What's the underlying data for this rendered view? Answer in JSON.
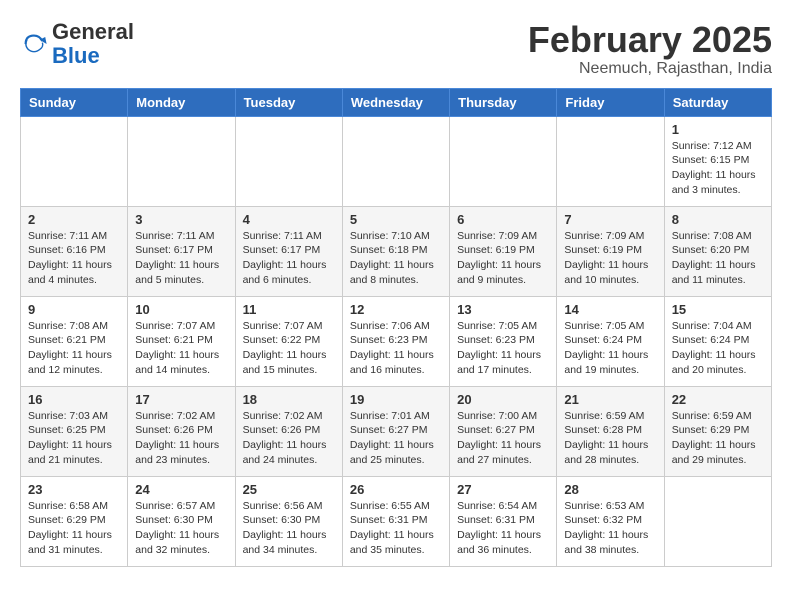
{
  "logo": {
    "general": "General",
    "blue": "Blue"
  },
  "title": "February 2025",
  "subtitle": "Neemuch, Rajasthan, India",
  "days_of_week": [
    "Sunday",
    "Monday",
    "Tuesday",
    "Wednesday",
    "Thursday",
    "Friday",
    "Saturday"
  ],
  "weeks": [
    [
      {
        "day": "",
        "info": ""
      },
      {
        "day": "",
        "info": ""
      },
      {
        "day": "",
        "info": ""
      },
      {
        "day": "",
        "info": ""
      },
      {
        "day": "",
        "info": ""
      },
      {
        "day": "",
        "info": ""
      },
      {
        "day": "1",
        "info": "Sunrise: 7:12 AM\nSunset: 6:15 PM\nDaylight: 11 hours\nand 3 minutes."
      }
    ],
    [
      {
        "day": "2",
        "info": "Sunrise: 7:11 AM\nSunset: 6:16 PM\nDaylight: 11 hours\nand 4 minutes."
      },
      {
        "day": "3",
        "info": "Sunrise: 7:11 AM\nSunset: 6:17 PM\nDaylight: 11 hours\nand 5 minutes."
      },
      {
        "day": "4",
        "info": "Sunrise: 7:11 AM\nSunset: 6:17 PM\nDaylight: 11 hours\nand 6 minutes."
      },
      {
        "day": "5",
        "info": "Sunrise: 7:10 AM\nSunset: 6:18 PM\nDaylight: 11 hours\nand 8 minutes."
      },
      {
        "day": "6",
        "info": "Sunrise: 7:09 AM\nSunset: 6:19 PM\nDaylight: 11 hours\nand 9 minutes."
      },
      {
        "day": "7",
        "info": "Sunrise: 7:09 AM\nSunset: 6:19 PM\nDaylight: 11 hours\nand 10 minutes."
      },
      {
        "day": "8",
        "info": "Sunrise: 7:08 AM\nSunset: 6:20 PM\nDaylight: 11 hours\nand 11 minutes."
      }
    ],
    [
      {
        "day": "9",
        "info": "Sunrise: 7:08 AM\nSunset: 6:21 PM\nDaylight: 11 hours\nand 12 minutes."
      },
      {
        "day": "10",
        "info": "Sunrise: 7:07 AM\nSunset: 6:21 PM\nDaylight: 11 hours\nand 14 minutes."
      },
      {
        "day": "11",
        "info": "Sunrise: 7:07 AM\nSunset: 6:22 PM\nDaylight: 11 hours\nand 15 minutes."
      },
      {
        "day": "12",
        "info": "Sunrise: 7:06 AM\nSunset: 6:23 PM\nDaylight: 11 hours\nand 16 minutes."
      },
      {
        "day": "13",
        "info": "Sunrise: 7:05 AM\nSunset: 6:23 PM\nDaylight: 11 hours\nand 17 minutes."
      },
      {
        "day": "14",
        "info": "Sunrise: 7:05 AM\nSunset: 6:24 PM\nDaylight: 11 hours\nand 19 minutes."
      },
      {
        "day": "15",
        "info": "Sunrise: 7:04 AM\nSunset: 6:24 PM\nDaylight: 11 hours\nand 20 minutes."
      }
    ],
    [
      {
        "day": "16",
        "info": "Sunrise: 7:03 AM\nSunset: 6:25 PM\nDaylight: 11 hours\nand 21 minutes."
      },
      {
        "day": "17",
        "info": "Sunrise: 7:02 AM\nSunset: 6:26 PM\nDaylight: 11 hours\nand 23 minutes."
      },
      {
        "day": "18",
        "info": "Sunrise: 7:02 AM\nSunset: 6:26 PM\nDaylight: 11 hours\nand 24 minutes."
      },
      {
        "day": "19",
        "info": "Sunrise: 7:01 AM\nSunset: 6:27 PM\nDaylight: 11 hours\nand 25 minutes."
      },
      {
        "day": "20",
        "info": "Sunrise: 7:00 AM\nSunset: 6:27 PM\nDaylight: 11 hours\nand 27 minutes."
      },
      {
        "day": "21",
        "info": "Sunrise: 6:59 AM\nSunset: 6:28 PM\nDaylight: 11 hours\nand 28 minutes."
      },
      {
        "day": "22",
        "info": "Sunrise: 6:59 AM\nSunset: 6:29 PM\nDaylight: 11 hours\nand 29 minutes."
      }
    ],
    [
      {
        "day": "23",
        "info": "Sunrise: 6:58 AM\nSunset: 6:29 PM\nDaylight: 11 hours\nand 31 minutes."
      },
      {
        "day": "24",
        "info": "Sunrise: 6:57 AM\nSunset: 6:30 PM\nDaylight: 11 hours\nand 32 minutes."
      },
      {
        "day": "25",
        "info": "Sunrise: 6:56 AM\nSunset: 6:30 PM\nDaylight: 11 hours\nand 34 minutes."
      },
      {
        "day": "26",
        "info": "Sunrise: 6:55 AM\nSunset: 6:31 PM\nDaylight: 11 hours\nand 35 minutes."
      },
      {
        "day": "27",
        "info": "Sunrise: 6:54 AM\nSunset: 6:31 PM\nDaylight: 11 hours\nand 36 minutes."
      },
      {
        "day": "28",
        "info": "Sunrise: 6:53 AM\nSunset: 6:32 PM\nDaylight: 11 hours\nand 38 minutes."
      },
      {
        "day": "",
        "info": ""
      }
    ]
  ]
}
